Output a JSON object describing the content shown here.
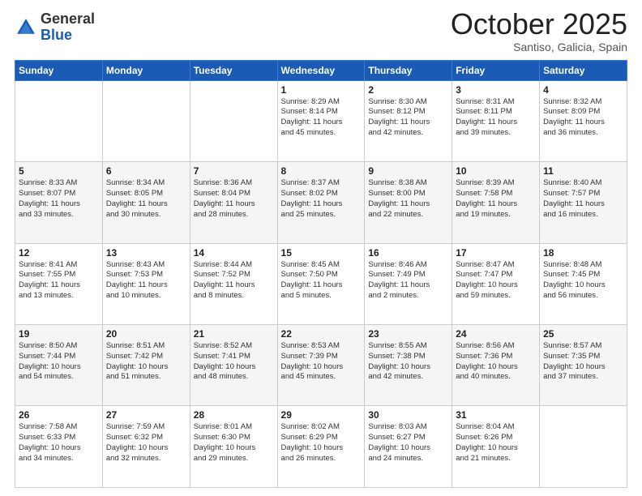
{
  "header": {
    "logo_general": "General",
    "logo_blue": "Blue",
    "title": "October 2025",
    "subtitle": "Santiso, Galicia, Spain"
  },
  "days_of_week": [
    "Sunday",
    "Monday",
    "Tuesday",
    "Wednesday",
    "Thursday",
    "Friday",
    "Saturday"
  ],
  "weeks": [
    [
      {
        "day": "",
        "info": ""
      },
      {
        "day": "",
        "info": ""
      },
      {
        "day": "",
        "info": ""
      },
      {
        "day": "1",
        "info": "Sunrise: 8:29 AM\nSunset: 8:14 PM\nDaylight: 11 hours\nand 45 minutes."
      },
      {
        "day": "2",
        "info": "Sunrise: 8:30 AM\nSunset: 8:12 PM\nDaylight: 11 hours\nand 42 minutes."
      },
      {
        "day": "3",
        "info": "Sunrise: 8:31 AM\nSunset: 8:11 PM\nDaylight: 11 hours\nand 39 minutes."
      },
      {
        "day": "4",
        "info": "Sunrise: 8:32 AM\nSunset: 8:09 PM\nDaylight: 11 hours\nand 36 minutes."
      }
    ],
    [
      {
        "day": "5",
        "info": "Sunrise: 8:33 AM\nSunset: 8:07 PM\nDaylight: 11 hours\nand 33 minutes."
      },
      {
        "day": "6",
        "info": "Sunrise: 8:34 AM\nSunset: 8:05 PM\nDaylight: 11 hours\nand 30 minutes."
      },
      {
        "day": "7",
        "info": "Sunrise: 8:36 AM\nSunset: 8:04 PM\nDaylight: 11 hours\nand 28 minutes."
      },
      {
        "day": "8",
        "info": "Sunrise: 8:37 AM\nSunset: 8:02 PM\nDaylight: 11 hours\nand 25 minutes."
      },
      {
        "day": "9",
        "info": "Sunrise: 8:38 AM\nSunset: 8:00 PM\nDaylight: 11 hours\nand 22 minutes."
      },
      {
        "day": "10",
        "info": "Sunrise: 8:39 AM\nSunset: 7:58 PM\nDaylight: 11 hours\nand 19 minutes."
      },
      {
        "day": "11",
        "info": "Sunrise: 8:40 AM\nSunset: 7:57 PM\nDaylight: 11 hours\nand 16 minutes."
      }
    ],
    [
      {
        "day": "12",
        "info": "Sunrise: 8:41 AM\nSunset: 7:55 PM\nDaylight: 11 hours\nand 13 minutes."
      },
      {
        "day": "13",
        "info": "Sunrise: 8:43 AM\nSunset: 7:53 PM\nDaylight: 11 hours\nand 10 minutes."
      },
      {
        "day": "14",
        "info": "Sunrise: 8:44 AM\nSunset: 7:52 PM\nDaylight: 11 hours\nand 8 minutes."
      },
      {
        "day": "15",
        "info": "Sunrise: 8:45 AM\nSunset: 7:50 PM\nDaylight: 11 hours\nand 5 minutes."
      },
      {
        "day": "16",
        "info": "Sunrise: 8:46 AM\nSunset: 7:49 PM\nDaylight: 11 hours\nand 2 minutes."
      },
      {
        "day": "17",
        "info": "Sunrise: 8:47 AM\nSunset: 7:47 PM\nDaylight: 10 hours\nand 59 minutes."
      },
      {
        "day": "18",
        "info": "Sunrise: 8:48 AM\nSunset: 7:45 PM\nDaylight: 10 hours\nand 56 minutes."
      }
    ],
    [
      {
        "day": "19",
        "info": "Sunrise: 8:50 AM\nSunset: 7:44 PM\nDaylight: 10 hours\nand 54 minutes."
      },
      {
        "day": "20",
        "info": "Sunrise: 8:51 AM\nSunset: 7:42 PM\nDaylight: 10 hours\nand 51 minutes."
      },
      {
        "day": "21",
        "info": "Sunrise: 8:52 AM\nSunset: 7:41 PM\nDaylight: 10 hours\nand 48 minutes."
      },
      {
        "day": "22",
        "info": "Sunrise: 8:53 AM\nSunset: 7:39 PM\nDaylight: 10 hours\nand 45 minutes."
      },
      {
        "day": "23",
        "info": "Sunrise: 8:55 AM\nSunset: 7:38 PM\nDaylight: 10 hours\nand 42 minutes."
      },
      {
        "day": "24",
        "info": "Sunrise: 8:56 AM\nSunset: 7:36 PM\nDaylight: 10 hours\nand 40 minutes."
      },
      {
        "day": "25",
        "info": "Sunrise: 8:57 AM\nSunset: 7:35 PM\nDaylight: 10 hours\nand 37 minutes."
      }
    ],
    [
      {
        "day": "26",
        "info": "Sunrise: 7:58 AM\nSunset: 6:33 PM\nDaylight: 10 hours\nand 34 minutes."
      },
      {
        "day": "27",
        "info": "Sunrise: 7:59 AM\nSunset: 6:32 PM\nDaylight: 10 hours\nand 32 minutes."
      },
      {
        "day": "28",
        "info": "Sunrise: 8:01 AM\nSunset: 6:30 PM\nDaylight: 10 hours\nand 29 minutes."
      },
      {
        "day": "29",
        "info": "Sunrise: 8:02 AM\nSunset: 6:29 PM\nDaylight: 10 hours\nand 26 minutes."
      },
      {
        "day": "30",
        "info": "Sunrise: 8:03 AM\nSunset: 6:27 PM\nDaylight: 10 hours\nand 24 minutes."
      },
      {
        "day": "31",
        "info": "Sunrise: 8:04 AM\nSunset: 6:26 PM\nDaylight: 10 hours\nand 21 minutes."
      },
      {
        "day": "",
        "info": ""
      }
    ]
  ]
}
